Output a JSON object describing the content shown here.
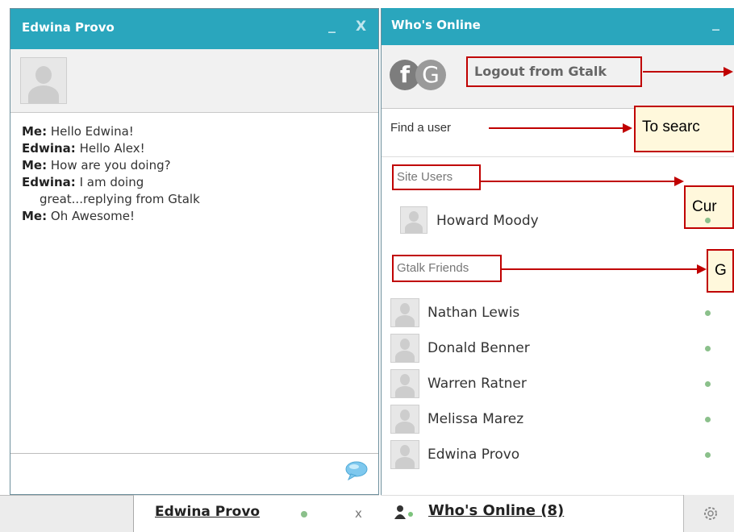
{
  "chat_window": {
    "title": "Edwina Provo",
    "minimize_label": "_",
    "close_label": "X",
    "messages": [
      {
        "sender": "Me:",
        "text": "Hello Edwina!",
        "cont": ""
      },
      {
        "sender": "Edwina:",
        "text": "Hello Alex!",
        "cont": ""
      },
      {
        "sender": "Me:",
        "text": "How are you doing?",
        "cont": ""
      },
      {
        "sender": "Edwina:",
        "text": "I am doing",
        "cont": "great...replying from Gtalk"
      },
      {
        "sender": "Me:",
        "text": "Oh Awesome!",
        "cont": ""
      }
    ],
    "icon_bubble": "chat-bubble-icon"
  },
  "chat_tab": {
    "name": "Edwina Provo",
    "close_label": "x",
    "status_color": "#8bc08b"
  },
  "online_panel": {
    "title": "Who's Online",
    "minimize_label": "_",
    "logo_f": "f",
    "logo_g": "G",
    "logout_label": "Logout from Gtalk",
    "search_placeholder": "Find a user",
    "site_users_label": "Site Users",
    "site_users": [
      "Howard Moody"
    ],
    "gtalk_friends_label": "Gtalk Friends",
    "gtalk_friends": [
      "Nathan Lewis",
      "Donald Benner",
      "Warren Ratner",
      "Melissa Marez",
      "Edwina Provo"
    ],
    "footer_label": "Who's Online (8)",
    "gear_icon": "gear-icon"
  },
  "annotations": {
    "search_callout": "To searc",
    "site_users_callout": "Cur",
    "gtalk_callout": "G"
  },
  "colors": {
    "titlebar": "#2aa6bd",
    "annotation": "#c00000",
    "online": "#8bc08b"
  }
}
